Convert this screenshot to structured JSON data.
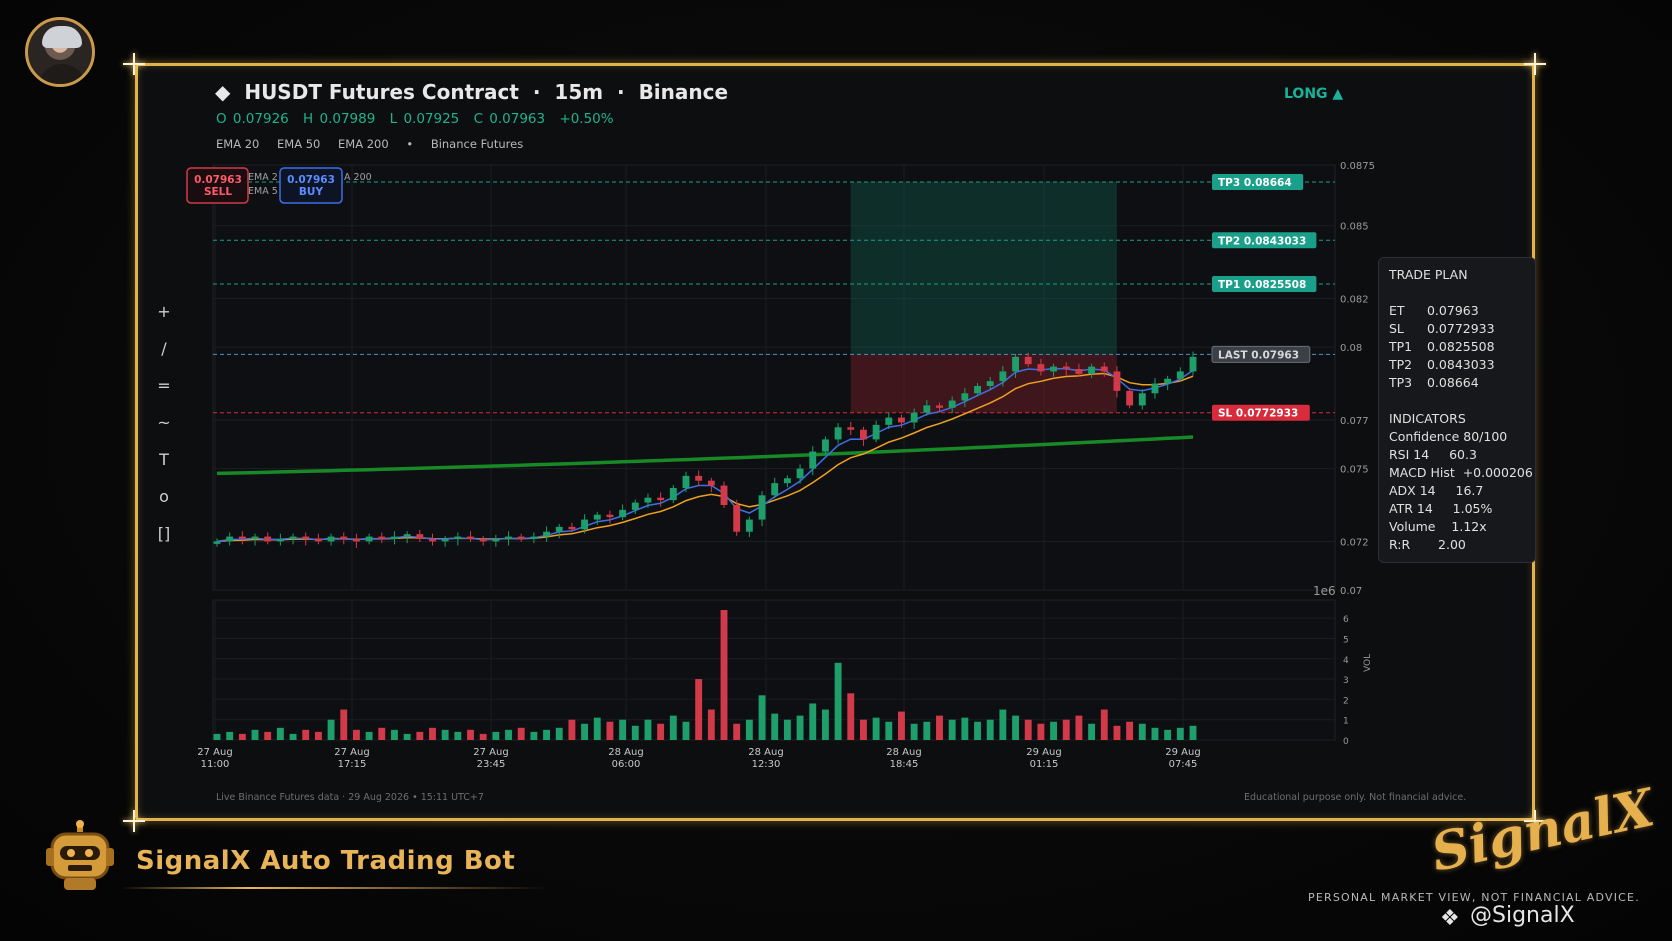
{
  "header": {
    "diamond": "◆",
    "symbol": "HUSDT Futures Contract",
    "sep": "·",
    "interval": "15m",
    "exchange": "Binance",
    "direction": "LONG ▲",
    "ohlc": {
      "o": "O 0.07926",
      "h": "H 0.07989",
      "l": "L 0.07925",
      "c": "C 0.07963",
      "change": "+0.50%"
    },
    "indicators": [
      "EMA 20",
      "EMA 50",
      "EMA 200",
      "•",
      "Binance Futures"
    ]
  },
  "order_buttons": {
    "sell_price": "0.07963",
    "sell_label": "SELL",
    "buy_price": "0.07963",
    "buy_label": "BUY",
    "legend_hidden": [
      "EMA 2",
      "EMA 5",
      "A 200"
    ]
  },
  "toolbar": [
    {
      "name": "crosshair-tool",
      "glyph": "+"
    },
    {
      "name": "trendline-tool",
      "glyph": "/"
    },
    {
      "name": "hline-tool",
      "glyph": "="
    },
    {
      "name": "curve-tool",
      "glyph": "~"
    },
    {
      "name": "text-tool",
      "glyph": "T"
    },
    {
      "name": "circle-tool",
      "glyph": "o"
    },
    {
      "name": "rect-tool",
      "glyph": "[]"
    }
  ],
  "chart_data": {
    "type": "candlestick",
    "title": "HUSDT Futures Contract · 15m · Binance",
    "x_tick_labels": [
      [
        "27 Aug",
        "11:00"
      ],
      [
        "27 Aug",
        "17:15"
      ],
      [
        "27 Aug",
        "23:45"
      ],
      [
        "28 Aug",
        "06:00"
      ],
      [
        "28 Aug",
        "12:30"
      ],
      [
        "28 Aug",
        "18:45"
      ],
      [
        "29 Aug",
        "01:15"
      ],
      [
        "29 Aug",
        "07:45"
      ]
    ],
    "y_ticks": [
      0.07,
      0.072,
      0.075,
      0.077,
      0.08,
      0.082,
      0.085,
      0.0875
    ],
    "y_tick_labels": [
      "0.07",
      "0.072",
      "0.075",
      "0.077",
      "0.08",
      "0.082",
      "0.085",
      "0.0875"
    ],
    "ylim": [
      0.07,
      0.0875
    ],
    "y_multiplier_label": "1e6",
    "closes": [
      0.072,
      0.0722,
      0.0721,
      0.0722,
      0.072,
      0.0721,
      0.0722,
      0.0721,
      0.072,
      0.0722,
      0.0721,
      0.072,
      0.0722,
      0.0721,
      0.0722,
      0.0723,
      0.0721,
      0.072,
      0.0721,
      0.0722,
      0.0721,
      0.072,
      0.0721,
      0.0722,
      0.0721,
      0.0722,
      0.0724,
      0.0726,
      0.0725,
      0.0729,
      0.0731,
      0.073,
      0.0733,
      0.0736,
      0.0738,
      0.0737,
      0.0742,
      0.0747,
      0.0745,
      0.0743,
      0.0735,
      0.0724,
      0.0729,
      0.0739,
      0.0744,
      0.0746,
      0.075,
      0.0757,
      0.0762,
      0.0767,
      0.0766,
      0.0762,
      0.0768,
      0.0771,
      0.0769,
      0.0773,
      0.0776,
      0.0775,
      0.0778,
      0.0781,
      0.0784,
      0.0786,
      0.079,
      0.0796,
      0.0793,
      0.079,
      0.0792,
      0.0791,
      0.0789,
      0.0792,
      0.079,
      0.0782,
      0.0776,
      0.0781,
      0.0785,
      0.0787,
      0.079,
      0.0796
    ],
    "ema20_end": 0.0788,
    "ema50_end": 0.0784,
    "ema200_start": 0.0748,
    "ema200_end": 0.0763,
    "levels": [
      {
        "name": "TP3",
        "label": "TP3  0.08664",
        "value": 0.0868,
        "color": "#1aa08a"
      },
      {
        "name": "TP2",
        "label": "TP2  0.0843033",
        "value": 0.0844,
        "color": "#1aa08a"
      },
      {
        "name": "TP1",
        "label": "TP1  0.0825508",
        "value": 0.0826,
        "color": "#1aa08a"
      },
      {
        "name": "LAST",
        "label": "LAST  0.07963",
        "value": 0.0797,
        "color": "#3a4046"
      },
      {
        "name": "SL",
        "label": "SL  0.0772933",
        "value": 0.0773,
        "color": "#d82c3c"
      }
    ],
    "volume": {
      "ylabel": "VOL",
      "ylim": [
        0,
        6.5
      ],
      "y_ticks": [
        0,
        1,
        2,
        3,
        4,
        5,
        6
      ],
      "values": [
        0.3,
        0.4,
        0.3,
        0.5,
        0.4,
        0.6,
        0.3,
        0.5,
        0.4,
        1.0,
        1.5,
        0.5,
        0.4,
        0.6,
        0.5,
        0.3,
        0.4,
        0.6,
        0.5,
        0.4,
        0.5,
        0.3,
        0.4,
        0.5,
        0.6,
        0.4,
        0.5,
        0.6,
        1.0,
        0.8,
        1.1,
        0.9,
        1.0,
        0.7,
        1.0,
        0.8,
        1.2,
        0.9,
        3.0,
        1.5,
        6.4,
        0.8,
        1.0,
        2.2,
        1.3,
        1.0,
        1.2,
        1.8,
        1.5,
        3.8,
        2.3,
        1.0,
        1.1,
        0.9,
        1.4,
        0.8,
        0.9,
        1.2,
        1.0,
        1.1,
        0.9,
        1.0,
        1.5,
        1.2,
        1.0,
        0.8,
        0.9,
        1.0,
        1.2,
        0.8,
        1.5,
        0.7,
        0.9,
        0.8,
        0.6,
        0.5,
        0.6,
        0.7
      ]
    }
  },
  "trade_plan": {
    "title": "TRADE PLAN",
    "rows": [
      {
        "k": "ET",
        "v": "0.07963"
      },
      {
        "k": "SL",
        "v": "0.0772933"
      },
      {
        "k": "TP1",
        "v": "0.0825508"
      },
      {
        "k": "TP2",
        "v": "0.0843033"
      },
      {
        "k": "TP3",
        "v": "0.08664"
      }
    ],
    "indicators_title": "INDICATORS",
    "indicators": [
      {
        "k": "Confidence",
        "v": "80/100"
      },
      {
        "k": "RSI 14",
        "v": "60.3"
      },
      {
        "k": "MACD Hist",
        "v": "+0.000206"
      },
      {
        "k": "ADX 14",
        "v": "16.7"
      },
      {
        "k": "ATR 14",
        "v": "1.05%"
      },
      {
        "k": "Volume",
        "v": "1.12x"
      },
      {
        "k": "R:R",
        "v": "2.00"
      }
    ]
  },
  "footer": {
    "left": "Live Binance Futures data  ·  29 Aug 2026 • 15:11 UTC+7",
    "right": "Educational purpose only. Not financial advice."
  },
  "branding": {
    "bot_title": "SignalX Auto Trading Bot",
    "logo_text": "SignalX",
    "disclaimer": "PERSONAL MARKET VIEW, NOT FINANCIAL ADVICE.",
    "handle": "@SignalX",
    "handle_icon": "❖"
  },
  "colors": {
    "up": "#1e9e6a",
    "down": "#d23a4a",
    "ema20": "#3d6fe6",
    "ema50": "#f0a020",
    "ema200": "#178a27",
    "gold": "#e2b24c"
  }
}
